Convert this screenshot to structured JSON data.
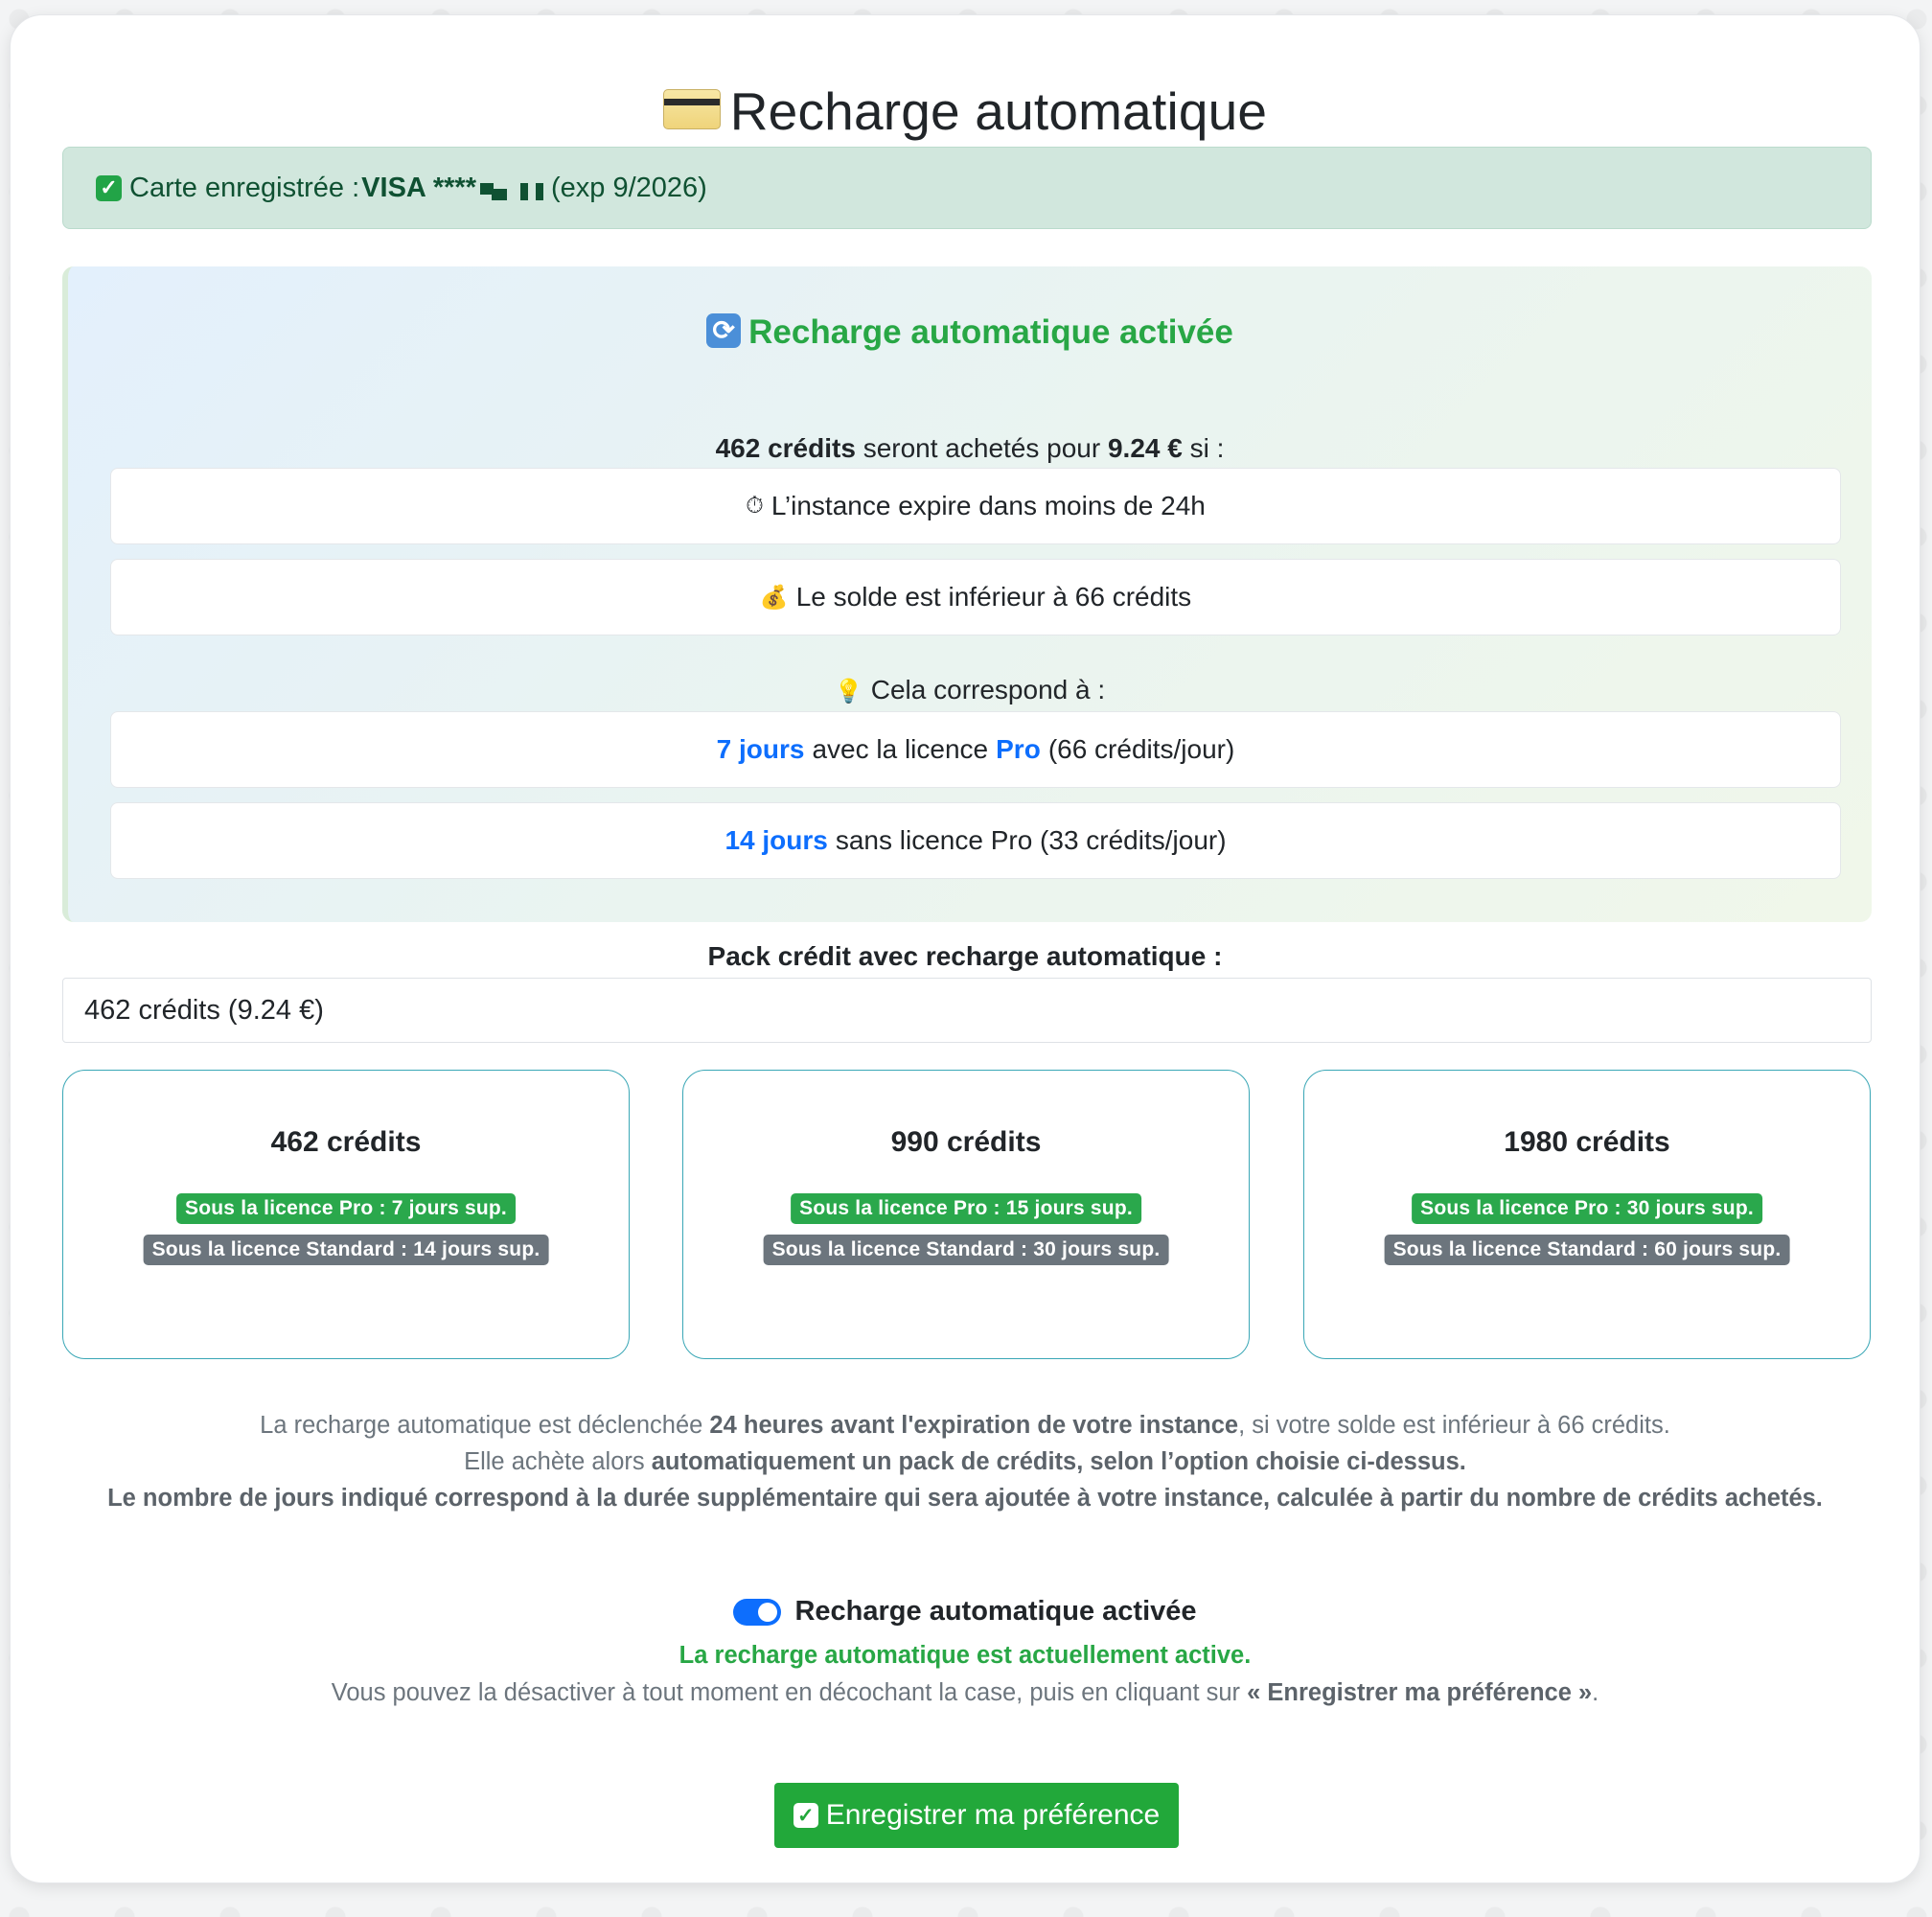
{
  "page": {
    "title": "Recharge automatique",
    "title_icon": "credit-card-icon"
  },
  "saved_card": {
    "label": "Carte enregistrée :",
    "brand_masked": "VISA ****",
    "expiry": "(exp 9/2026)",
    "icon": "check-icon"
  },
  "auto_recharge": {
    "title": "Recharge automatique activée",
    "title_icon": "sync-icon",
    "summary_credits": "462 crédits",
    "summary_middle": " seront achetés pour ",
    "summary_price": "9.24 €",
    "summary_end": " si :",
    "conditions": [
      {
        "icon": "stopwatch-icon",
        "text": "L’instance expire dans moins de 24h"
      },
      {
        "icon": "money-bag-icon",
        "text": "Le solde est inférieur à 66 crédits"
      }
    ],
    "hint_icon": "lightbulb-icon",
    "hint": "Cela correspond à :",
    "equivalents": [
      {
        "days": "7 jours",
        "middle": "avec la licence",
        "license": "Pro",
        "rate": "(66 crédits/jour)"
      },
      {
        "days": "14 jours",
        "rest": "sans licence Pro (33 crédits/jour)"
      }
    ]
  },
  "pack": {
    "label": "Pack crédit avec recharge automatique :",
    "selected": "462 crédits (9.24 €)",
    "options": [
      {
        "title": "462 crédits",
        "pro": "Sous la licence Pro : 7 jours sup.",
        "standard": "Sous la licence Standard : 14 jours sup."
      },
      {
        "title": "990 crédits",
        "pro": "Sous la licence Pro : 15 jours sup.",
        "standard": "Sous la licence Standard : 30 jours sup."
      },
      {
        "title": "1980 crédits",
        "pro": "Sous la licence Pro : 30 jours sup.",
        "standard": "Sous la licence Standard : 60 jours sup."
      }
    ]
  },
  "info": {
    "line1_a": "La recharge automatique est déclenchée ",
    "line1_b": "24 heures avant l'expiration de votre instance",
    "line1_c": ", si votre solde est inférieur à 66 crédits.",
    "line2_a": "Elle achète alors ",
    "line2_b": "automatiquement un pack de crédits, selon l’option choisie ci-dessus.",
    "line3": "Le nombre de jours indiqué correspond à la durée supplémentaire qui sera ajoutée à votre instance, calculée à partir du nombre de crédits achetés."
  },
  "toggle": {
    "label": "Recharge automatique activée",
    "checked": true,
    "status": "La recharge automatique est actuellement active.",
    "desc_a": "Vous pouvez la désactiver à tout moment en décochant la case, puis en cliquant sur ",
    "desc_b": "« Enregistrer ma préférence »",
    "desc_c": "."
  },
  "save_button": {
    "label": "Enregistrer ma préférence",
    "icon": "check-icon"
  },
  "colors": {
    "success": "#28a745",
    "primary": "#0d6efd",
    "alert_bg": "#d1e7dd",
    "muted": "#6c757d"
  }
}
